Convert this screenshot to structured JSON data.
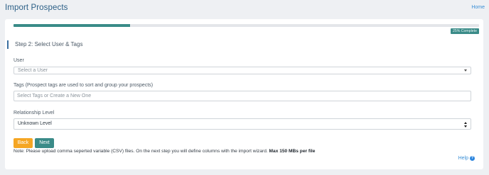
{
  "header": {
    "title": "Import Prospects",
    "home_link": "Home"
  },
  "progress": {
    "percent": 25,
    "label": "25% Complete"
  },
  "step": {
    "title": "Step 2: Select User & Tags"
  },
  "form": {
    "user": {
      "label": "User",
      "placeholder": "Select a User"
    },
    "tags": {
      "label": "Tags (Prospect tags are used to sort and group your prospects)",
      "placeholder": "Select Tags or Create a New One"
    },
    "relationship": {
      "label": "Relationship Level",
      "selected": "Unknown Level"
    }
  },
  "buttons": {
    "back": "Back",
    "next": "Next"
  },
  "note": {
    "text": "Note: Please upload comma seperted variable (CSV) files. On the next step you will define columns with the import wizard.",
    "bold": "Max 150 MBs per file"
  },
  "help": {
    "label": "Help",
    "icon": "question-circle-icon"
  },
  "colors": {
    "accent": "#3a8b88",
    "back_button": "#f5a623",
    "title": "#2b5f86",
    "link": "#3a8fd6"
  }
}
